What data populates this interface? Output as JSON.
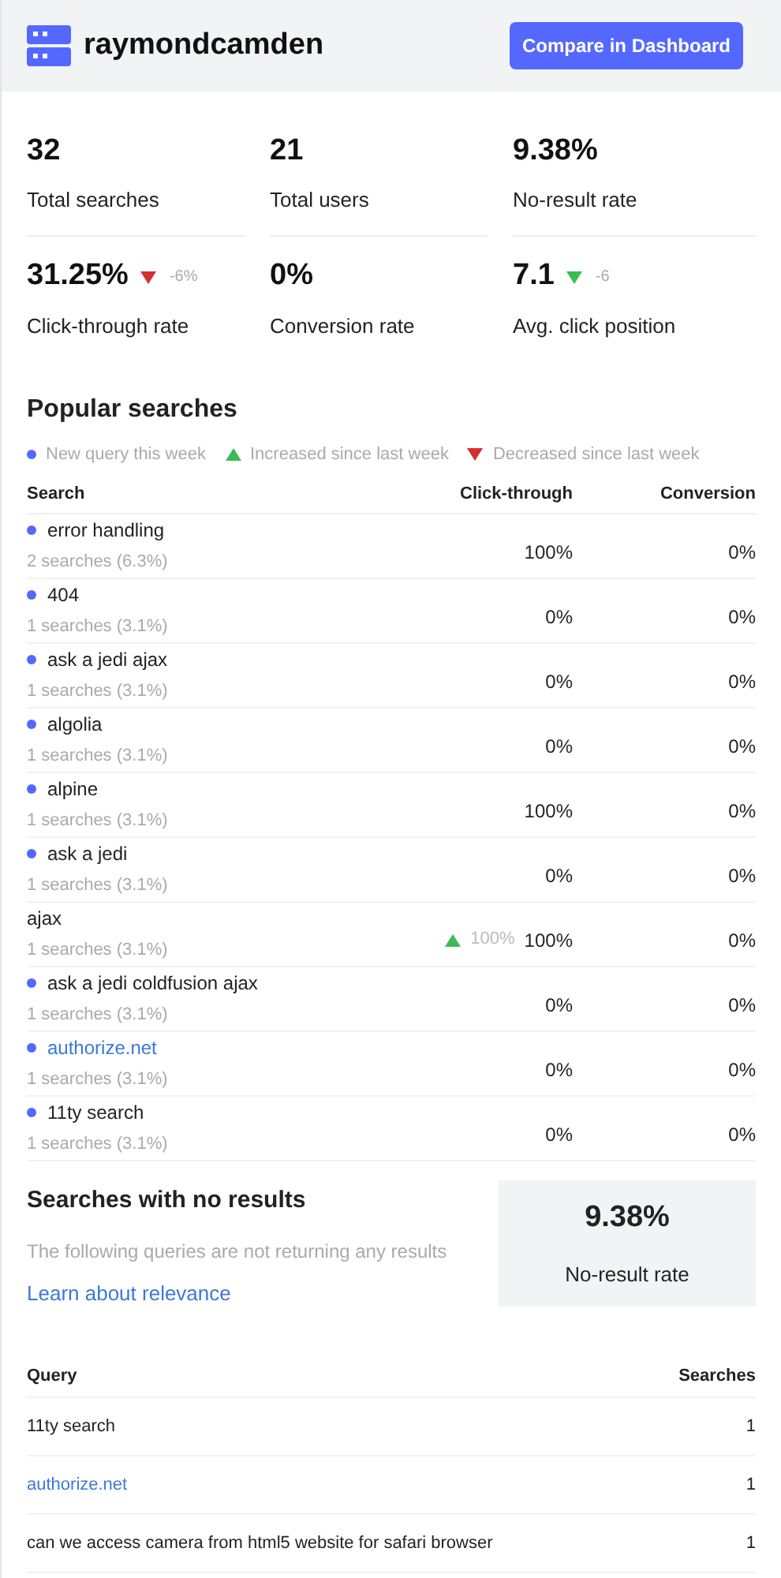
{
  "header": {
    "title": "raymondcamden",
    "button": "Compare in Dashboard"
  },
  "stats": [
    {
      "value": "32",
      "label": "Total searches"
    },
    {
      "value": "21",
      "label": "Total users"
    },
    {
      "value": "9.38%",
      "label": "No-result rate"
    },
    {
      "value": "31.25%",
      "label": "Click-through rate",
      "trend": {
        "up": false,
        "color": "#d32f2f",
        "text": "-6%"
      }
    },
    {
      "value": "0%",
      "label": "Conversion rate"
    },
    {
      "value": "7.1",
      "label": "Avg. click position",
      "trend": {
        "up": false,
        "color": "#3cba54",
        "text": "-6"
      }
    }
  ],
  "popular": {
    "title": "Popular searches",
    "legend": [
      {
        "kind": "dot",
        "color": "#5468ff",
        "label": "New query this week"
      },
      {
        "kind": "up",
        "color": "#3cba54",
        "label": "Increased since last week"
      },
      {
        "kind": "down",
        "color": "#d32f2f",
        "label": "Decreased since last week"
      }
    ],
    "columns": [
      "Search",
      "Click-through",
      "Conversion"
    ],
    "rows": [
      {
        "query": "error handling",
        "new": true,
        "link": false,
        "count": "2 searches (6.3%)",
        "click_through": "100%",
        "conversion": "0%"
      },
      {
        "query": "404",
        "new": true,
        "link": false,
        "count": "1 searches (3.1%)",
        "click_through": "0%",
        "conversion": "0%"
      },
      {
        "query": "ask a jedi ajax",
        "new": true,
        "link": false,
        "count": "1 searches (3.1%)",
        "click_through": "0%",
        "conversion": "0%"
      },
      {
        "query": "algolia",
        "new": true,
        "link": false,
        "count": "1 searches (3.1%)",
        "click_through": "0%",
        "conversion": "0%"
      },
      {
        "query": "alpine",
        "new": true,
        "link": false,
        "count": "1 searches (3.1%)",
        "click_through": "100%",
        "conversion": "0%"
      },
      {
        "query": "ask a jedi",
        "new": true,
        "link": false,
        "count": "1 searches (3.1%)",
        "click_through": "0%",
        "conversion": "0%"
      },
      {
        "query": "ajax",
        "new": false,
        "link": false,
        "count": "1 searches (3.1%)",
        "trend": {
          "up": true,
          "text": "100%"
        },
        "click_through": "100%",
        "conversion": "0%"
      },
      {
        "query": "ask a jedi coldfusion ajax",
        "new": true,
        "link": false,
        "count": "1 searches (3.1%)",
        "click_through": "0%",
        "conversion": "0%"
      },
      {
        "query": "authorize.net",
        "new": true,
        "link": true,
        "count": "1 searches (3.1%)",
        "click_through": "0%",
        "conversion": "0%"
      },
      {
        "query": "11ty search",
        "new": true,
        "link": false,
        "count": "1 searches (3.1%)",
        "click_through": "0%",
        "conversion": "0%"
      }
    ]
  },
  "no_results": {
    "title": "Searches with no results",
    "description": "The following queries are not returning any results",
    "link": "Learn about relevance",
    "rate_value": "9.38%",
    "rate_label": "No-result rate",
    "columns": [
      "Query",
      "Searches"
    ],
    "rows": [
      {
        "query": "11ty search",
        "link": false,
        "searches": "1"
      },
      {
        "query": "authorize.net",
        "link": true,
        "searches": "1"
      },
      {
        "query": "can we access camera from html5 website for safari browser",
        "link": false,
        "searches": "1"
      }
    ]
  }
}
